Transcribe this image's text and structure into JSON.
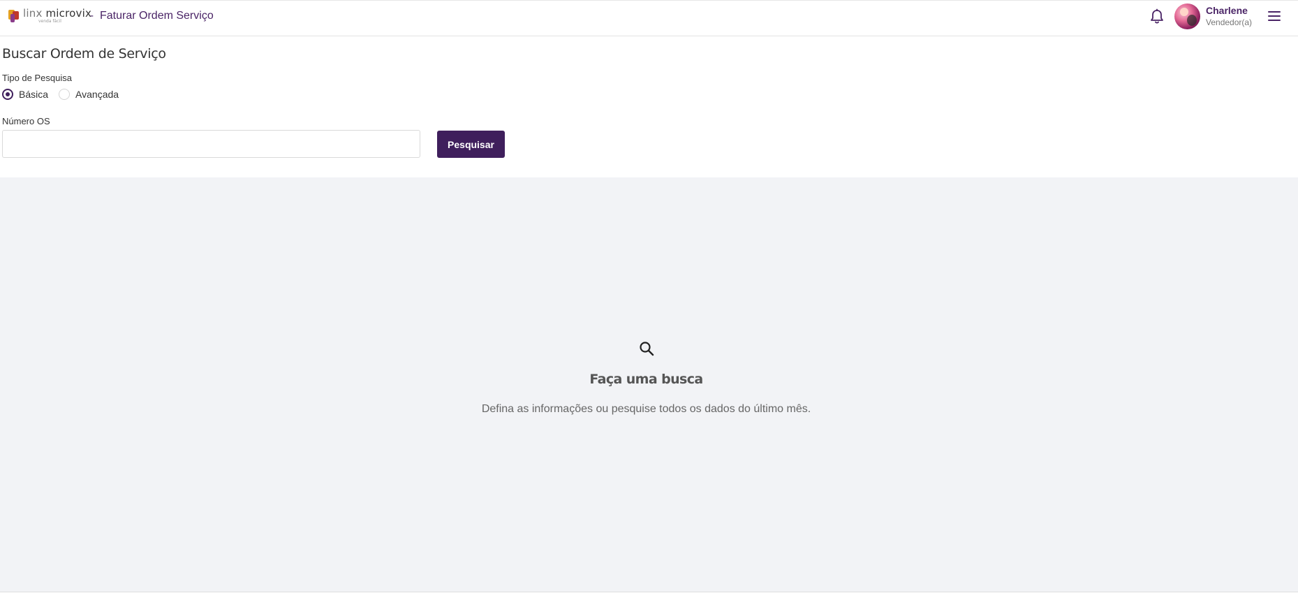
{
  "header": {
    "brand_linx": "linx",
    "brand_microvix": "microvix",
    "brand_sub": "venda fácil",
    "separator": "-",
    "title": "Faturar Ordem Serviço",
    "user": {
      "name": "Charlene",
      "role": "Vendedor(a)"
    }
  },
  "form": {
    "page_title": "Buscar Ordem de Serviço",
    "search_type_label": "Tipo de Pesquisa",
    "options": [
      {
        "label": "Básica",
        "selected": true
      },
      {
        "label": "Avançada",
        "selected": false
      }
    ],
    "os_number_label": "Número OS",
    "os_number_value": "",
    "search_button": "Pesquisar"
  },
  "empty_state": {
    "title": "Faça uma busca",
    "description": "Defina as informações ou pesquise todos os dados do último mês."
  },
  "colors": {
    "primary": "#3f1f5c",
    "header_text": "#4a2466",
    "empty_bg": "#f2f3f6"
  }
}
